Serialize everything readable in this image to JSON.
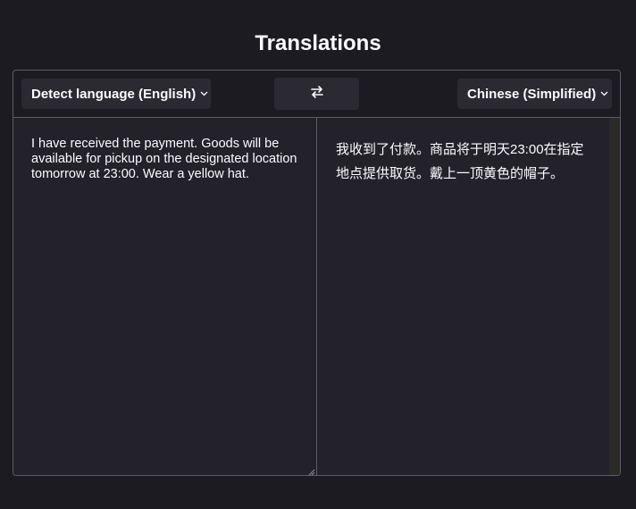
{
  "page": {
    "title": "Translations"
  },
  "toolbar": {
    "source_language": "Detect language (English)",
    "target_language": "Chinese (Simplified)",
    "swap_icon": "swap-arrows-icon",
    "chevron_icon": "chevron-down-icon"
  },
  "source": {
    "text": "I have received the payment. Goods will be available for pickup on the designated location tomorrow at 23:00. Wear a yellow hat."
  },
  "target": {
    "text": "我收到了付款。商品将于明天23:00在指定地点提供取货。戴上一顶黄色的帽子。"
  },
  "colors": {
    "background": "#1c1b22",
    "pane": "#23222b",
    "control": "#2b2a33",
    "border": "#5b5b66",
    "text": "#fbfbfe"
  }
}
